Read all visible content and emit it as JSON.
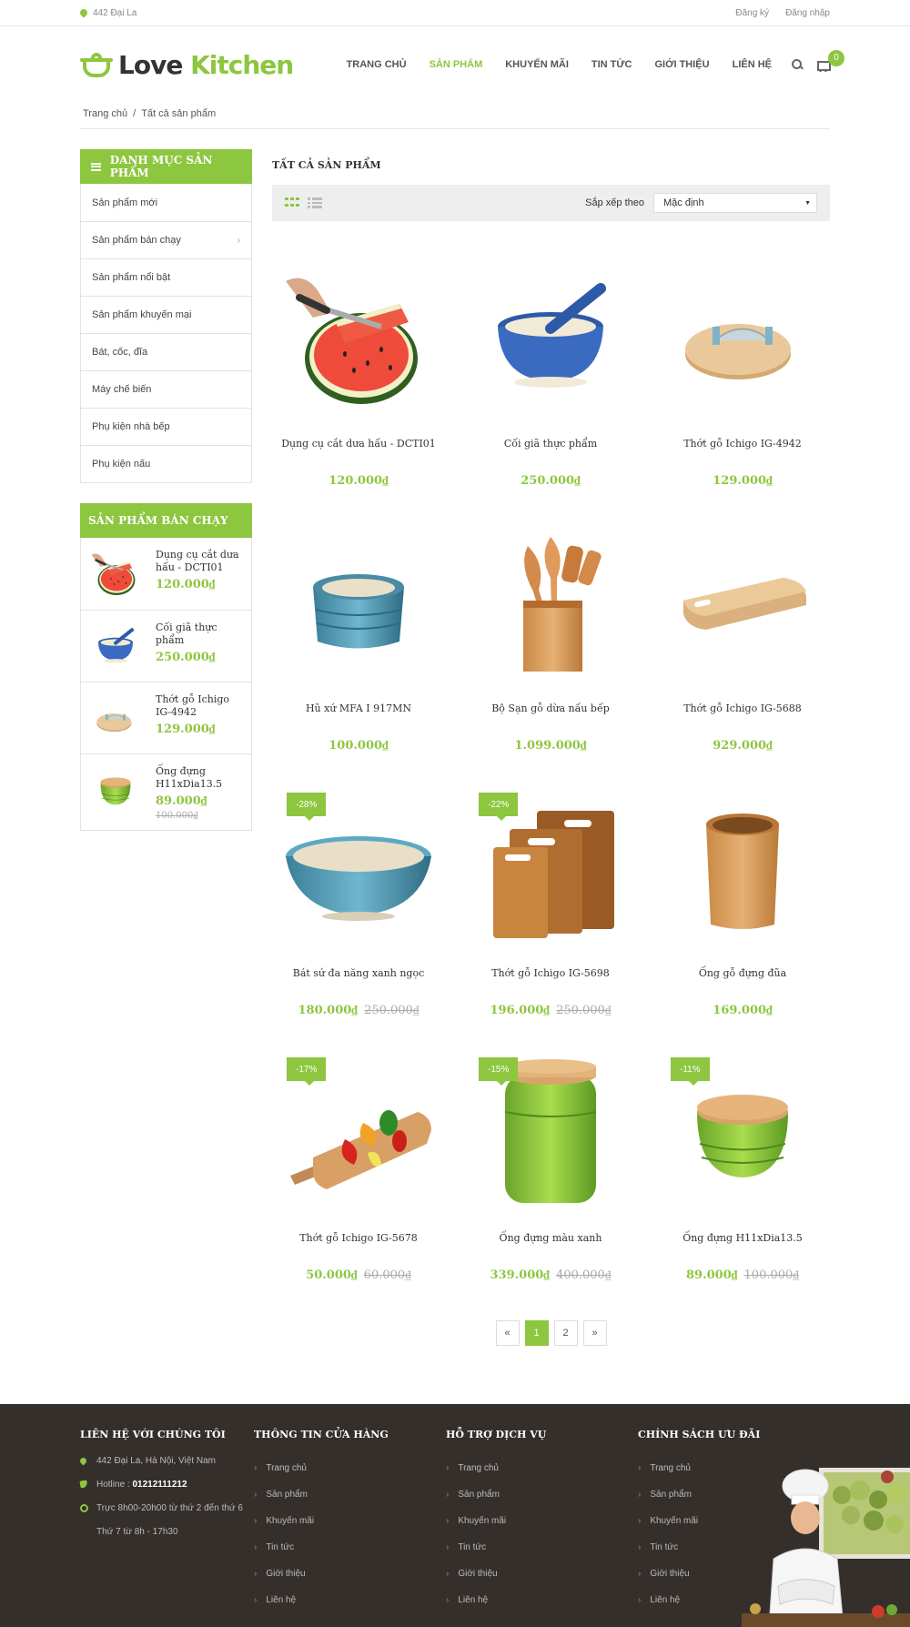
{
  "topbar": {
    "address": "442 Đại La",
    "register": "Đăng ký",
    "login": "Đăng nhập"
  },
  "header": {
    "logo_a": "Love",
    "logo_b": "Kitchen",
    "nav": [
      "TRANG CHỦ",
      "SẢN PHẨM",
      "KHUYẾN MÃI",
      "TIN TỨC",
      "GIỚI THIỆU",
      "LIÊN HỆ"
    ],
    "active_nav": "SẢN PHẨM",
    "cart_count": "0"
  },
  "breadcrumb": {
    "home": "Trang chủ",
    "sep": "/",
    "current": "Tất cả sản phẩm"
  },
  "sidebar": {
    "category_title": "DANH MỤC SẢN PHẨM",
    "categories": [
      "Sản phẩm mới",
      "Sản phẩm bán chạy",
      "Sản phẩm nổi bật",
      "Sản phẩm khuyến mại",
      "Bát, cốc, đĩa",
      "Máy chế biến",
      "Phụ kiện nhà bếp",
      "Phụ kiện nấu"
    ],
    "best_title": "SẢN PHẨM BÁN CHẠY",
    "best": [
      {
        "name": "Dụng cụ cắt dưa hấu - DCTI01",
        "price": "120.000₫",
        "old": ""
      },
      {
        "name": "Cối giã thực phẩm",
        "price": "250.000₫",
        "old": ""
      },
      {
        "name": "Thớt gỗ Ichigo IG-4942",
        "price": "129.000₫",
        "old": ""
      },
      {
        "name": "Ống đựng H11xDia13.5",
        "price": "89.000₫",
        "old": "100.000₫"
      }
    ]
  },
  "content": {
    "title": "TẤT CẢ SẢN PHẨM",
    "sort_label": "Sắp xếp theo",
    "sort_value": "Mặc định",
    "products": [
      {
        "name": "Dụng cụ cắt dưa hấu - DCTI01",
        "price": "120.000₫",
        "old": "",
        "sale": "",
        "img": "watermelon"
      },
      {
        "name": "Cối giã thực phẩm",
        "price": "250.000₫",
        "old": "",
        "sale": "",
        "img": "mortar"
      },
      {
        "name": "Thớt gỗ Ichigo IG-4942",
        "price": "129.000₫",
        "old": "",
        "sale": "",
        "img": "roundboard"
      },
      {
        "name": "Hũ xứ MFA I 917MN",
        "price": "100.000₫",
        "old": "",
        "sale": "",
        "img": "ramekin"
      },
      {
        "name": "Bộ Sạn gỗ dừa nấu bếp",
        "price": "1.099.000₫",
        "old": "",
        "sale": "",
        "img": "utensils"
      },
      {
        "name": "Thớt gỗ Ichigo IG-5688",
        "price": "929.000₫",
        "old": "",
        "sale": "",
        "img": "board"
      },
      {
        "name": "Bát sứ đa năng xanh ngọc",
        "price": "180.000₫",
        "old": "250.000₫",
        "sale": "-28%",
        "img": "bowl"
      },
      {
        "name": "Thớt gỗ Ichigo IG-5698",
        "price": "196.000₫",
        "old": "250.000₫",
        "sale": "-22%",
        "img": "boards"
      },
      {
        "name": "Ống gỗ đựng đũa",
        "price": "169.000₫",
        "old": "",
        "sale": "",
        "img": "holder"
      },
      {
        "name": "Thớt gỗ Ichigo IG-5678",
        "price": "50.000₫",
        "old": "60.000₫",
        "sale": "-17%",
        "img": "peppers"
      },
      {
        "name": "Ống đựng màu xanh",
        "price": "339.000₫",
        "old": "400.000₫",
        "sale": "-15%",
        "img": "greenjar"
      },
      {
        "name": "Ống đựng H11xDia13.5",
        "price": "89.000₫",
        "old": "100.000₫",
        "sale": "-11%",
        "img": "greenjar2"
      }
    ],
    "pager": {
      "prev": "«",
      "pages": [
        "1",
        "2"
      ],
      "active": "1",
      "next": "»"
    }
  },
  "footer": {
    "contact_title": "LIÊN HỆ VỚI CHÚNG TÔI",
    "address": "442 Đại La, Hà Nội, Việt Nam",
    "hotline_label": "Hotline :",
    "hotline": "01212111212",
    "hours1": "Trực 8h00-20h00 từ thứ 2 đến thứ 6",
    "hours2": "Thứ 7 từ 8h - 17h30",
    "columns": [
      {
        "title": "THÔNG TIN CỬA HÀNG",
        "links": [
          "Trang chủ",
          "Sản phẩm",
          "Khuyến mãi",
          "Tin tức",
          "Giới thiệu",
          "Liên hệ"
        ]
      },
      {
        "title": "HỖ TRỢ DỊCH VỤ",
        "links": [
          "Trang chủ",
          "Sản phẩm",
          "Khuyến mãi",
          "Tin tức",
          "Giới thiệu",
          "Liên hệ"
        ]
      },
      {
        "title": "CHÍNH SÁCH ƯU ĐÃI",
        "links": [
          "Trang chủ",
          "Sản phẩm",
          "Khuyến mãi",
          "Tin tức",
          "Giới thiệu",
          "Liên hệ"
        ]
      }
    ]
  },
  "colors": {
    "accent": "#8dc63f",
    "footer_bg": "#352f2c"
  }
}
